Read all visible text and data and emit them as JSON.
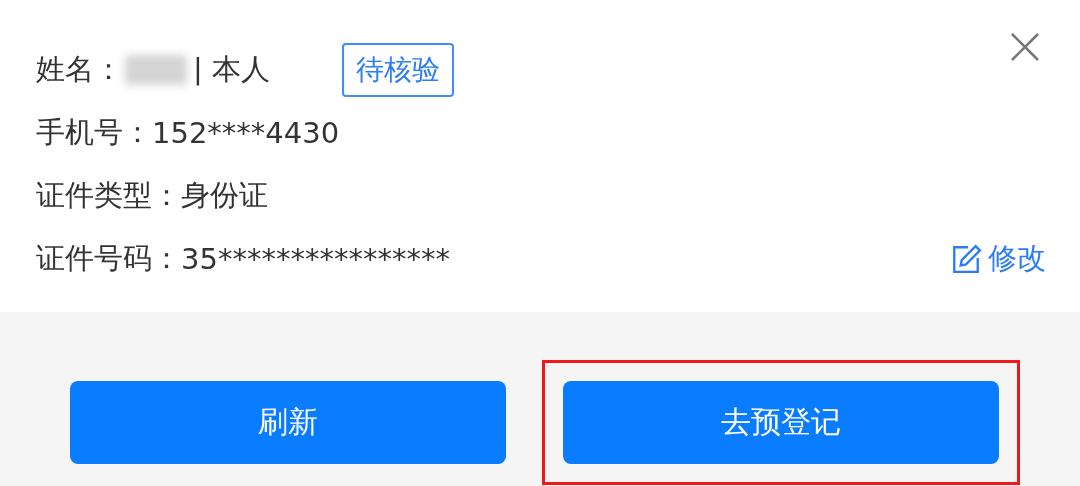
{
  "person": {
    "name_label": "姓名：",
    "name_redacted": true,
    "relation": "| 本人",
    "status_badge": "待核验"
  },
  "fields": [
    {
      "label": "手机号：",
      "value": "152****4430"
    },
    {
      "label": "证件类型：",
      "value": "身份证"
    },
    {
      "label": "证件号码：",
      "value": "35****************"
    }
  ],
  "edit_link": "修改",
  "buttons": [
    {
      "label": "刷新",
      "highlighted": false
    },
    {
      "label": "去预登记",
      "highlighted": true
    }
  ]
}
